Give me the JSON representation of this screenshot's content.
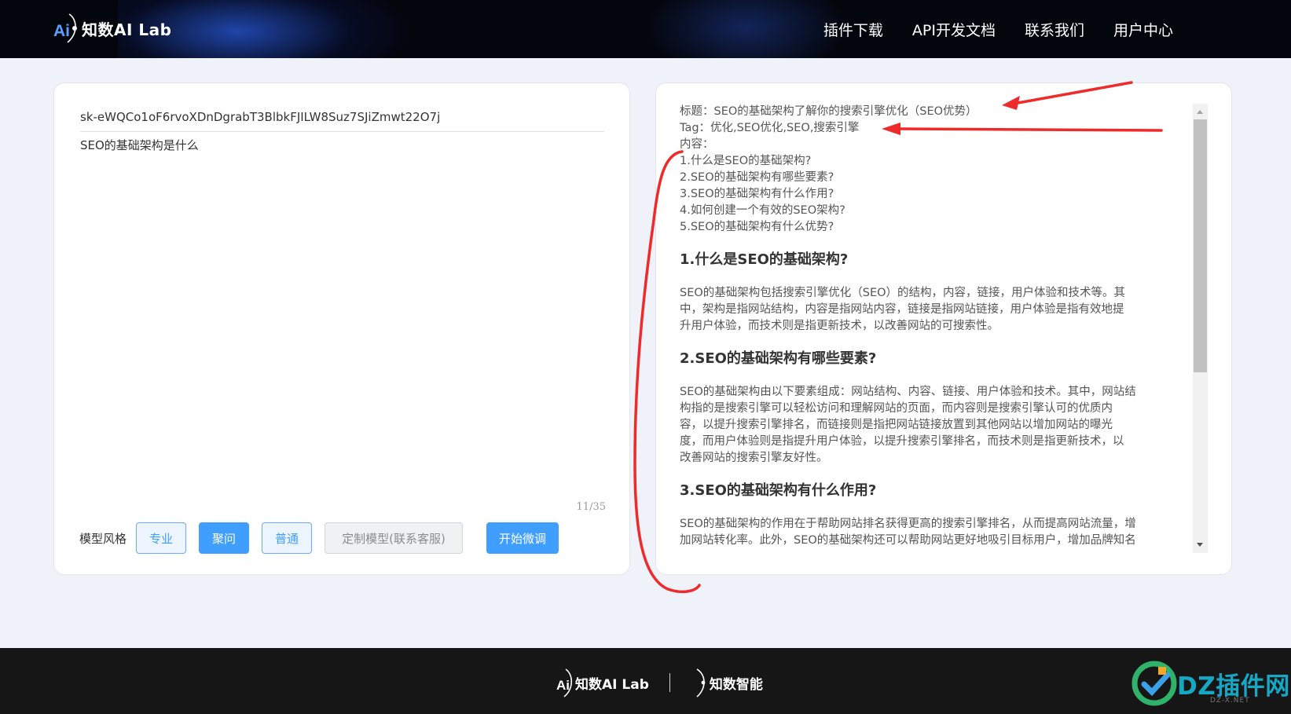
{
  "header": {
    "logo_text": "知数AI Lab",
    "logo_mark": "Ai",
    "nav": [
      "插件下载",
      "API开发文档",
      "联系我们",
      "用户中心"
    ]
  },
  "input_panel": {
    "api_key": "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",
    "prompt": "SEO的基础架构是什么",
    "counter": "11/35",
    "style_label": "模型风格",
    "styles": [
      "专业",
      "聚问",
      "普通"
    ],
    "custom_model": "定制模型(联系客服)",
    "start_button": "开始微调"
  },
  "output_panel": {
    "title_line": "标题：SEO的基础架构了解你的搜索引擎优化（SEO优势）",
    "tag_line": "Tag：优化,SEO优化,SEO,搜索引擎",
    "content_label": "内容：",
    "outline": [
      "1.什么是SEO的基础架构?",
      "2.SEO的基础架构有哪些要素?",
      "3.SEO的基础架构有什么作用?",
      "4.如何创建一个有效的SEO架构?",
      "5.SEO的基础架构有什么优势?"
    ],
    "sections": [
      {
        "heading": "1.什么是SEO的基础架构?",
        "lines": [
          "SEO的基础架构包括搜索引擎优化（SEO）的结构，内容，链接，用户体验和技术等。其",
          "中，架构是指网站结构，内容是指网站内容，链接是指网站链接，用户体验是指有效地提",
          "升用户体验，而技术则是指更新技术，以改善网站的可搜索性。"
        ]
      },
      {
        "heading": "2.SEO的基础架构有哪些要素?",
        "lines": [
          "SEO的基础架构由以下要素组成：网站结构、内容、链接、用户体验和技术。其中，网站结",
          "构指的是搜索引擎可以轻松访问和理解网站的页面，而内容则是搜索引擎认可的优质内",
          "容，以提升搜索引擎排名，而链接则是指把网站链接放置到其他网站以增加网站的曝光",
          "度，而用户体验则是指提升用户体验，以提升搜索引擎排名，而技术则是指更新技术，以",
          "改善网站的搜索引擎友好性。"
        ]
      },
      {
        "heading": "3.SEO的基础架构有什么作用?",
        "lines": [
          "SEO的基础架构的作用在于帮助网站排名获得更高的搜索引擎排名，从而提高网站流量，增",
          "加网站转化率。此外，SEO的基础架构还可以帮助网站更好地吸引目标用户，增加品牌知名"
        ]
      }
    ]
  },
  "footer": {
    "logo_left": "知数AI Lab",
    "logo_right": "知数智能"
  },
  "watermark": {
    "text": "DZ插件网",
    "sub": "DZ-X.NET"
  },
  "colors": {
    "primary": "#409eff",
    "annotation": "#ee2a2a"
  }
}
